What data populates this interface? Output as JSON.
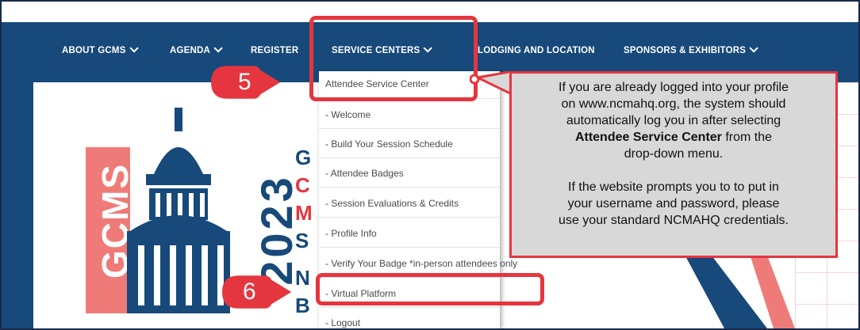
{
  "nav": {
    "about": "ABOUT GCMS",
    "agenda": "AGENDA",
    "register": "REGISTER",
    "service_centers": "SERVICE CENTERS",
    "lodging": "LODGING AND LOCATION",
    "sponsors": "SPONSORS & EXHIBITORS"
  },
  "dropdown": {
    "items": [
      "Attendee Service Center",
      "- Welcome",
      "- Build Your Session Schedule",
      "- Attendee Badges",
      "- Session Evaluations & Credits",
      "- Profile Info",
      "- Verify Your Badge *in-person attendees only",
      "- Virtual Platform",
      "- Logout"
    ]
  },
  "hero": {
    "vertical_text": "GCMS",
    "year_text": "2023",
    "word1": "G",
    "word2": "C",
    "word3": "M",
    "word4": "S",
    "word5": "N",
    "word6": "B"
  },
  "callouts": {
    "step5": "5",
    "step6": "6"
  },
  "tooltip": {
    "line1": "If you are already logged into your profile",
    "line2": "on www.ncmahq.org, the system should",
    "line3": "automatically log you in after selecting",
    "bold": "Attendee Service Center",
    "line4_rest": " from the",
    "line5": "drop-down menu.",
    "para2_line1": "If the website prompts you to to put in",
    "para2_line2": "your username and password, please",
    "para2_line3": "use your standard NCMAHQ credentials."
  },
  "colors": {
    "nav_blue": "#17497a",
    "accent_red": "#e5363f",
    "logo_coral": "#ef7b78"
  }
}
